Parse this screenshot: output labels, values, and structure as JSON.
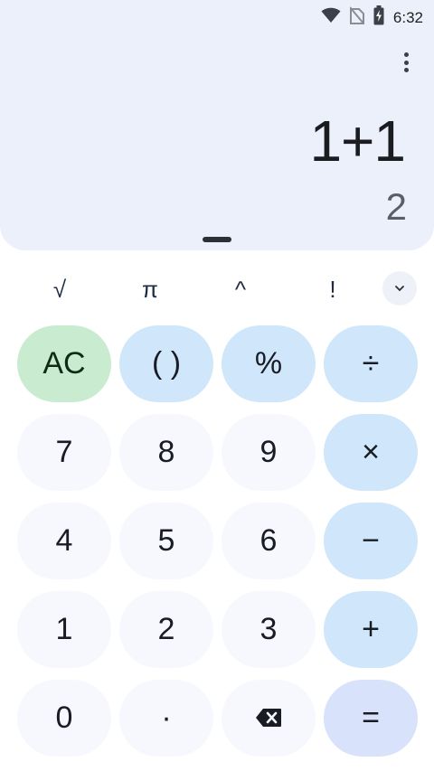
{
  "status_bar": {
    "time": "6:32",
    "icons": [
      "wifi-icon",
      "no-sim-icon",
      "battery-charging-icon"
    ]
  },
  "display": {
    "formula": "1+1",
    "result": "2"
  },
  "scientific_row": {
    "keys": [
      "√",
      "π",
      "^",
      "!"
    ],
    "expand_icon": "chevron-down-icon"
  },
  "keypad": {
    "rows": [
      [
        "AC",
        "( )",
        "%",
        "÷"
      ],
      [
        "7",
        "8",
        "9",
        "×"
      ],
      [
        "4",
        "5",
        "6",
        "−"
      ],
      [
        "1",
        "2",
        "3",
        "+"
      ],
      [
        "0",
        "·",
        "backspace-icon",
        "="
      ]
    ]
  },
  "colors": {
    "display_bg": "#ecf0fb",
    "number_key": "#f6f8fd",
    "operator_key": "#cfe6fb",
    "clear_key": "#c9ecd0",
    "equals_key": "#d8e2fb"
  }
}
